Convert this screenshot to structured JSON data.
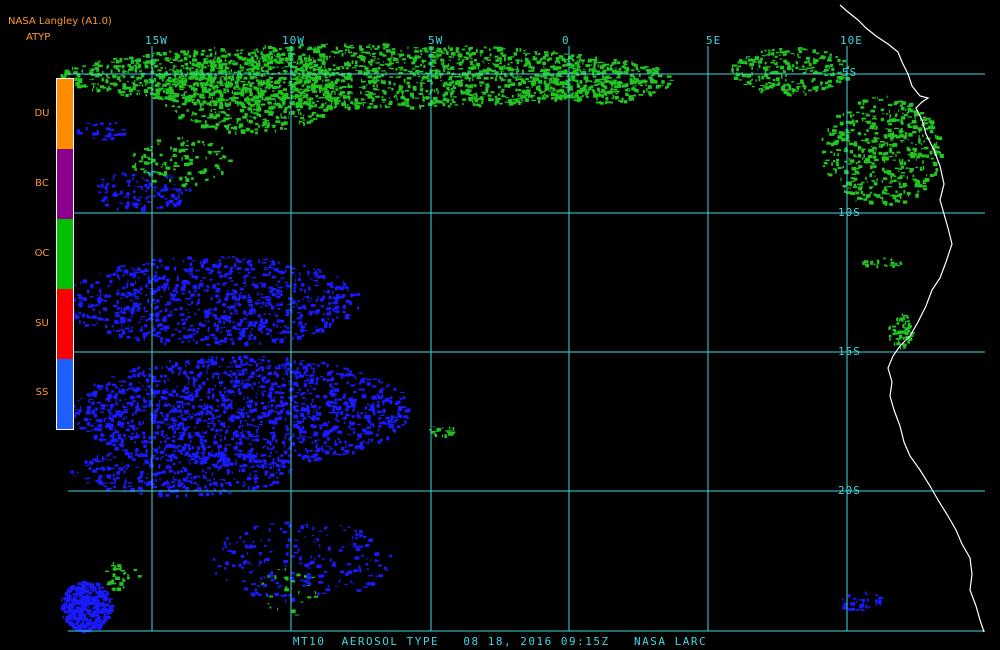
{
  "header": {
    "title": "NASA Langley (A1.0)",
    "product": "ATYP"
  },
  "legend": {
    "items": [
      {
        "label": "DU",
        "color": "#ff8c00"
      },
      {
        "label": "BC",
        "color": "#8b008b"
      },
      {
        "label": "OC",
        "color": "#00c000"
      },
      {
        "label": "SU",
        "color": "#ff0000"
      },
      {
        "label": "SS",
        "color": "#1e5fff"
      }
    ]
  },
  "grid": {
    "longitude_labels": [
      "15W",
      "10W",
      "5W",
      "0",
      "5E",
      "10E"
    ],
    "latitude_labels": [
      "5S",
      "10S",
      "15S",
      "20S"
    ],
    "color": "#40d8e0"
  },
  "colors": {
    "background": "#000000",
    "coastline": "#ffffff",
    "organic_carbon": "#22c422",
    "sea_salt": "#1a1aff"
  },
  "footer": {
    "caption": "MT10  AEROSOL TYPE   08 18, 2016 09:15Z   NASA LARC"
  }
}
